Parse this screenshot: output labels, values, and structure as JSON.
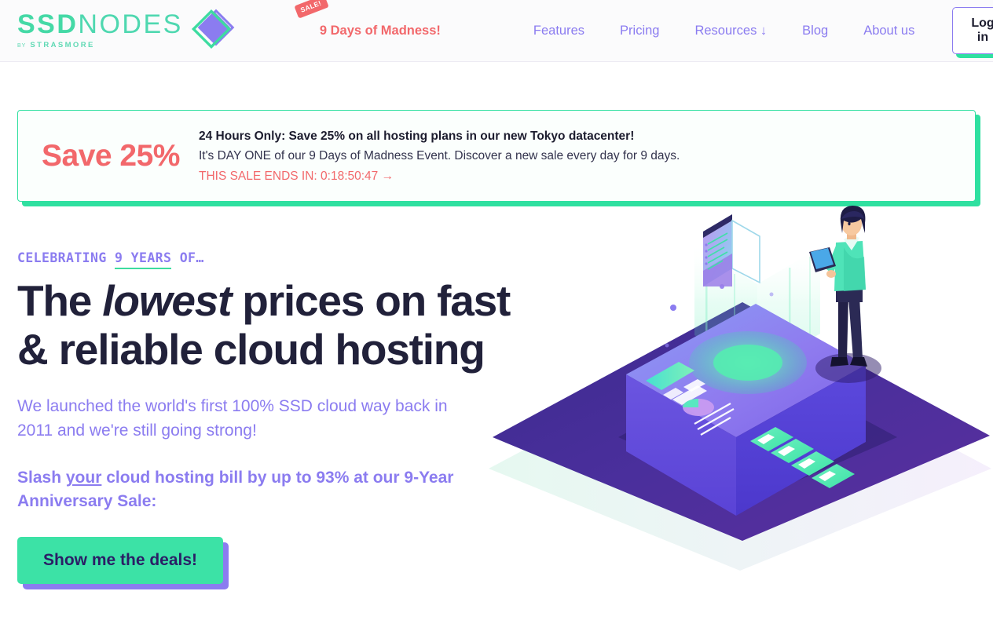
{
  "brand": {
    "logo_primary": "SSD",
    "logo_secondary": "NODES",
    "logo_by": "BY",
    "logo_parent": "STRASMORE",
    "accent_green": "#3ddca0",
    "accent_purple": "#8b7cf0",
    "accent_coral": "#f2686b",
    "dark_navy": "#21213a"
  },
  "header": {
    "sale_badge": "SALE!",
    "sale_link": "9 Days of Madness!",
    "nav_items": [
      {
        "label": "Features"
      },
      {
        "label": "Pricing"
      },
      {
        "label": "Resources ↓"
      },
      {
        "label": "Blog"
      },
      {
        "label": "About us"
      }
    ],
    "login_label": "Log in"
  },
  "banner": {
    "save_amount": "Save 25%",
    "headline": "24 Hours Only: Save 25% on all hosting plans in our new Tokyo datacenter!",
    "subline": "It's DAY ONE of our 9 Days of Madness Event. Discover a new sale every day for 9 days.",
    "timer_label": "THIS SALE ENDS IN:",
    "timer_value": "0:18:50:47",
    "timer_arrow": "→",
    "timer_full": "THIS SALE ENDS IN: 0:18:50:47 →"
  },
  "hero": {
    "eyebrow_pre": "CELEBRATING ",
    "eyebrow_highlight": "9 YEARS",
    "eyebrow_post": " OF…",
    "title_part1": "The ",
    "title_italic": "lowest",
    "title_part2": " prices on fast & reliable cloud hosting",
    "paragraph1": "We launched the world's first 100% SSD cloud way back in 2011 and we're still going strong!",
    "paragraph2_pre": "Slash ",
    "paragraph2_underline": "your",
    "paragraph2_post": " cloud hosting bill by up to 93% at our 9-Year Anniversary Sale:",
    "cta_label": "Show me the deals!",
    "illustration_name": "isometric-cloud-platform-illustration"
  }
}
